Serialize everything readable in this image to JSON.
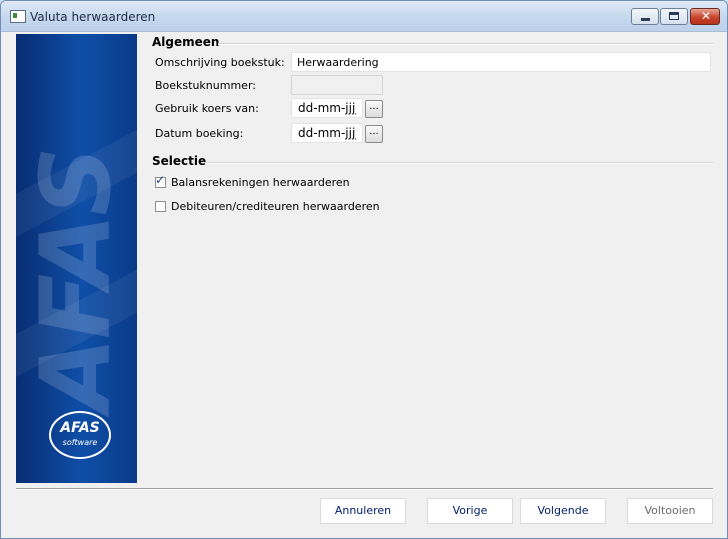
{
  "window": {
    "title": "Valuta herwaarderen",
    "close_glyph": "✕"
  },
  "banner": {
    "watermark": "AFAS",
    "logo_line1": "AFAS",
    "logo_line2": "software"
  },
  "algemeen": {
    "title": "Algemeen",
    "omschrijving_label": "Omschrijving boekstuk:",
    "omschrijving_value": "Herwaardering",
    "boekstuknummer_label": "Boekstuknummer:",
    "boekstuknummer_value": "",
    "gebruik_koers_label": "Gebruik koers van:",
    "gebruik_koers_value": "dd-mm-jjjj",
    "datum_boeking_label": "Datum boeking:",
    "datum_boeking_value": "dd-mm-jjjj",
    "picker_label": "..."
  },
  "selectie": {
    "title": "Selectie",
    "balans_label": "Balansrekeningen herwaarderen",
    "balans_checked": true,
    "debiteuren_label": "Debiteuren/crediteuren herwaarderen",
    "debiteuren_checked": false,
    "tick": "✓"
  },
  "footer": {
    "annuleren": "Annuleren",
    "vorige": "Vorige",
    "volgende": "Volgende",
    "voltooien": "Voltooien"
  }
}
